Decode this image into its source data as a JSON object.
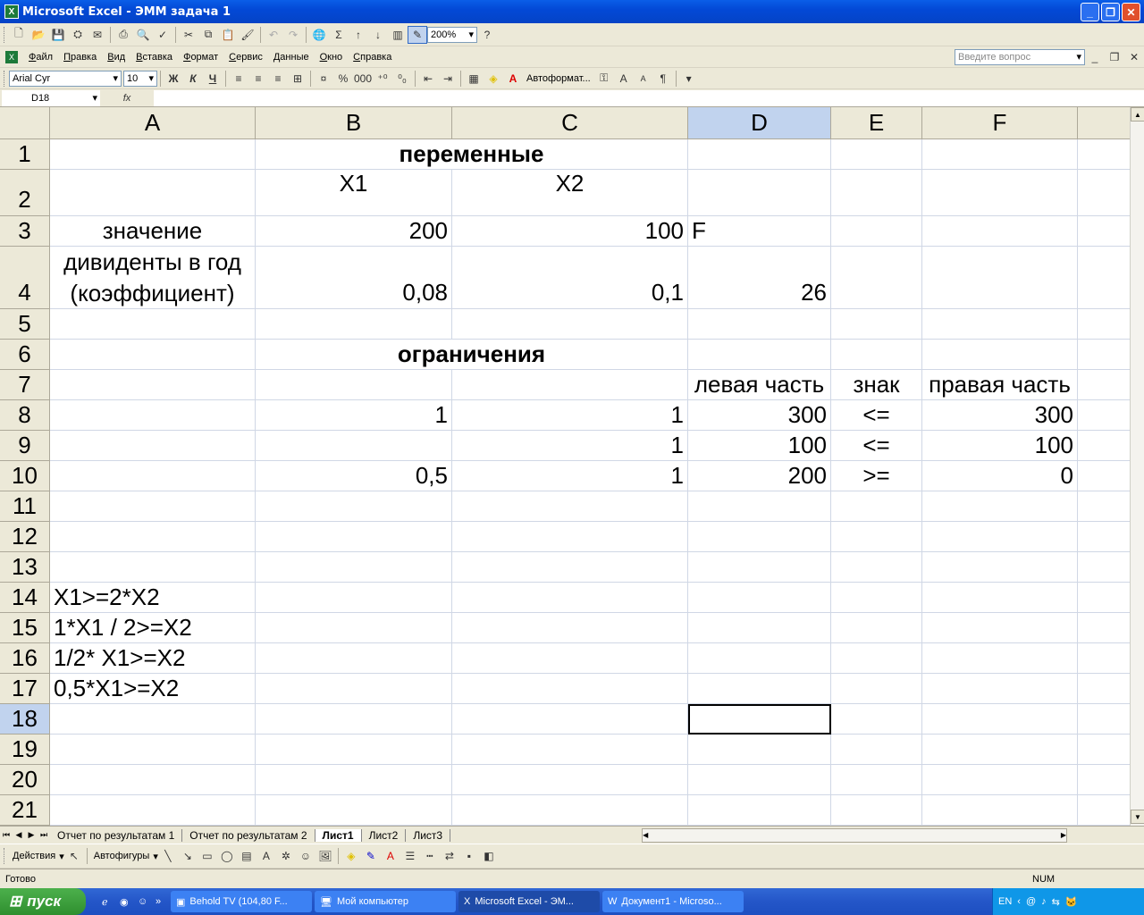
{
  "window": {
    "title": "Microsoft Excel - ЭММ задача 1"
  },
  "toolbar": {
    "zoom": "200%"
  },
  "menu": {
    "items": [
      "Файл",
      "Правка",
      "Вид",
      "Вставка",
      "Формат",
      "Сервис",
      "Данные",
      "Окно",
      "Справка"
    ],
    "help_placeholder": "Введите вопрос"
  },
  "format": {
    "font": "Arial Cyr",
    "size": "10",
    "bold": "Ж",
    "italic": "К",
    "underline": "Ч",
    "autoformat": "Автоформат..."
  },
  "formula_bar": {
    "name_box": "D18",
    "fx": "fx",
    "content": ""
  },
  "columns": [
    "A",
    "B",
    "C",
    "D",
    "E",
    "F"
  ],
  "selected": {
    "col": "D",
    "row": "18"
  },
  "rows": [
    {
      "n": "1",
      "A": "",
      "B": "переменные",
      "C": "",
      "D": "",
      "E": "",
      "F": ""
    },
    {
      "n": "2",
      "A": "",
      "B": "X1",
      "C": "X2",
      "D": "",
      "E": "",
      "F": ""
    },
    {
      "n": "3",
      "A": "значение",
      "B": "200",
      "C": "100",
      "D": "F",
      "E": "",
      "F": ""
    },
    {
      "n": "4",
      "A": "дивиденты в год\n(коэффициент)",
      "B": "0,08",
      "C": "0,1",
      "D": "26",
      "E": "",
      "F": ""
    },
    {
      "n": "5",
      "A": "",
      "B": "",
      "C": "",
      "D": "",
      "E": "",
      "F": ""
    },
    {
      "n": "6",
      "A": "",
      "B": "ограничения",
      "C": "",
      "D": "",
      "E": "",
      "F": ""
    },
    {
      "n": "7",
      "A": "",
      "B": "",
      "C": "",
      "D": "левая часть",
      "E": "знак",
      "F": "правая часть"
    },
    {
      "n": "8",
      "A": "",
      "B": "1",
      "C": "1",
      "D": "300",
      "E": "<=",
      "F": "300"
    },
    {
      "n": "9",
      "A": "",
      "B": "",
      "C": "1",
      "D": "100",
      "E": "<=",
      "F": "100"
    },
    {
      "n": "10",
      "A": "",
      "B": "0,5",
      "C": "1",
      "D": "200",
      "E": ">=",
      "F": "0"
    },
    {
      "n": "11",
      "A": "",
      "B": "",
      "C": "",
      "D": "",
      "E": "",
      "F": ""
    },
    {
      "n": "12",
      "A": "",
      "B": "",
      "C": "",
      "D": "",
      "E": "",
      "F": ""
    },
    {
      "n": "13",
      "A": "",
      "B": "",
      "C": "",
      "D": "",
      "E": "",
      "F": ""
    },
    {
      "n": "14",
      "A": "X1>=2*X2",
      "B": "",
      "C": "",
      "D": "",
      "E": "",
      "F": ""
    },
    {
      "n": "15",
      "A": "1*X1 / 2>=X2",
      "B": "",
      "C": "",
      "D": "",
      "E": "",
      "F": ""
    },
    {
      "n": "16",
      "A": "1/2* X1>=X2",
      "B": "",
      "C": "",
      "D": "",
      "E": "",
      "F": ""
    },
    {
      "n": "17",
      "A": "0,5*X1>=X2",
      "B": "",
      "C": "",
      "D": "",
      "E": "",
      "F": ""
    },
    {
      "n": "18",
      "A": "",
      "B": "",
      "C": "",
      "D": "",
      "E": "",
      "F": ""
    },
    {
      "n": "19",
      "A": "",
      "B": "",
      "C": "",
      "D": "",
      "E": "",
      "F": ""
    },
    {
      "n": "20",
      "A": "",
      "B": "",
      "C": "",
      "D": "",
      "E": "",
      "F": ""
    },
    {
      "n": "21",
      "A": "",
      "B": "",
      "C": "",
      "D": "",
      "E": "",
      "F": ""
    }
  ],
  "sheet_tabs": [
    "Отчет по результатам 1",
    "Отчет по результатам 2",
    "Лист1",
    "Лист2",
    "Лист3"
  ],
  "active_sheet": "Лист1",
  "drawing": {
    "actions": "Действия",
    "autoshapes": "Автофигуры"
  },
  "status": {
    "left": "Готово",
    "num": "NUM"
  },
  "taskbar": {
    "start": "пуск",
    "items": [
      "Behold TV (104,80 F...",
      "Мой компьютер",
      "Microsoft Excel - ЭМ...",
      "Документ1 - Microso..."
    ],
    "lang": "EN"
  }
}
